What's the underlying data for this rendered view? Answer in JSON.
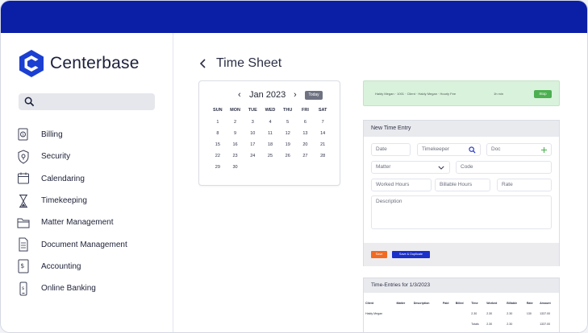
{
  "brand": {
    "name": "Centerbase",
    "color": "#1b3fd1"
  },
  "sidebar": {
    "search": {
      "placeholder": ""
    },
    "items": [
      {
        "label": "Billing",
        "icon": "billing-icon"
      },
      {
        "label": "Security",
        "icon": "security-icon"
      },
      {
        "label": "Calendaring",
        "icon": "calendar-icon"
      },
      {
        "label": "Timekeeping",
        "icon": "hourglass-icon"
      },
      {
        "label": "Matter Management",
        "icon": "folder-icon"
      },
      {
        "label": "Document Management",
        "icon": "document-icon"
      },
      {
        "label": "Accounting",
        "icon": "accounting-icon"
      },
      {
        "label": "Online Banking",
        "icon": "phone-icon"
      }
    ]
  },
  "page": {
    "title": "Time Sheet"
  },
  "calendar": {
    "month": "Jan 2023",
    "today_label": "Today",
    "weekdays": [
      "SUN",
      "MON",
      "TUE",
      "WED",
      "THU",
      "FRI",
      "SAT"
    ],
    "weeks": [
      [
        "1",
        "2",
        "3",
        "4",
        "5",
        "6",
        "7"
      ],
      [
        "8",
        "9",
        "10",
        "11",
        "12",
        "13",
        "14"
      ],
      [
        "15",
        "16",
        "17",
        "18",
        "19",
        "20",
        "21"
      ],
      [
        "22",
        "23",
        "24",
        "25",
        "26",
        "27",
        "28"
      ],
      [
        "29",
        "30",
        "",
        "",
        "",
        "",
        ""
      ]
    ]
  },
  "timer_banner": {
    "text": "Haldy Megan · 1001 · Client · Haldy Megan · Hourly Fee",
    "time": "1h min",
    "stop_label": "Stop",
    "color": "#4caf50"
  },
  "new_entry": {
    "title": "New Time Entry",
    "fields": {
      "date": "Date",
      "timekeeper": "Timekeeper",
      "doc": "Doc",
      "matter": "Matter",
      "code": "Code",
      "worked_hours": "Worked Hours",
      "billable_hours": "Billable Hours",
      "rate": "Rate",
      "description": "Description"
    },
    "save_label": "Save",
    "save_duplicate_label": "Save & Duplicate",
    "save_color": "#f26a21",
    "duplicate_color": "#1b2fc9"
  },
  "time_entries": {
    "title": "Time-Entries for 1/3/2023",
    "columns": [
      "Client",
      "Matter",
      "Description",
      "Paid",
      "Billed",
      "Time",
      "Worked",
      "Billable",
      "Rate",
      "Amount"
    ],
    "rows": [
      [
        "Haldy Megan",
        "",
        "",
        "",
        "",
        "2.30",
        "2.30",
        "2.30",
        "130",
        "1337.00"
      ]
    ],
    "totals": [
      "",
      "",
      "",
      "",
      "",
      "Totals",
      "2.30",
      "2.30",
      "",
      "1337.00"
    ]
  }
}
